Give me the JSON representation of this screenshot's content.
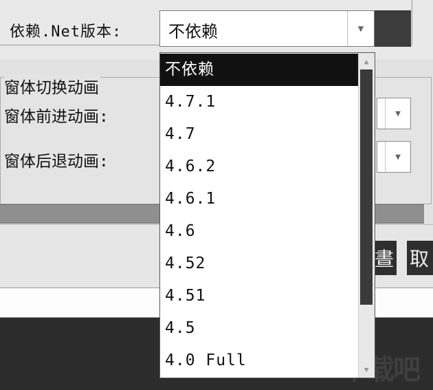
{
  "dependency": {
    "label": "依赖.Net版本:",
    "selected": "不依赖",
    "options": [
      "不依赖",
      "4.7.1",
      "4.7",
      "4.6.2",
      "4.6.1",
      "4.6",
      "4.52",
      "4.51",
      "4.5",
      "4.0 Full"
    ]
  },
  "animation": {
    "group_title": "窗体切换动画",
    "forward_label": "窗体前进动画:",
    "back_label": "窗体后退动画:"
  },
  "buttons": {
    "confirm_fragment": "晝",
    "cancel_fragment": "取"
  },
  "watermark": "下载吧",
  "icons": {
    "dropdown_arrow": "chevron-down-icon",
    "scroll_up": "scroll-up-arrow-icon",
    "scroll_down": "scroll-down-arrow-icon"
  },
  "colors": {
    "selected_item_bg": "#111111",
    "selected_item_text": "#ffffff",
    "scroll_thumb": "#3a3a3a"
  }
}
